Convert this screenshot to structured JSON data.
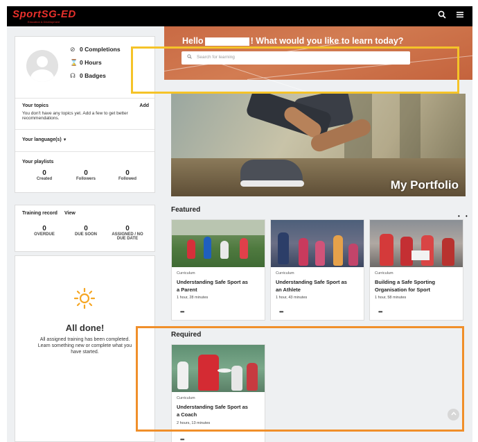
{
  "app": {
    "logo": "SportSG-ED",
    "logo_sub": "Education & Development"
  },
  "header": {
    "search_icon": "search-icon",
    "menu_icon": "hamburger-menu-icon"
  },
  "hero": {
    "greeting_before": "Hello",
    "greeting_after": "! What would you like to learn today?",
    "search_placeholder": "Search for learning"
  },
  "profile": {
    "completions": "0",
    "completions_label": "Completions",
    "hours": "0",
    "hours_label": "Hours",
    "badges": "0",
    "badges_label": "Badges"
  },
  "topics": {
    "title": "Your topics",
    "add": "Add",
    "empty_text": "You don't have any topics yet. Add a few to get better recommendations."
  },
  "languages": {
    "title": "Your language(s)",
    "chevron": "▼"
  },
  "playlists": {
    "title": "Your playlists",
    "created": "0",
    "created_label": "Created",
    "followers": "0",
    "followers_label": "Followers",
    "followed": "0",
    "followed_label": "Followed"
  },
  "training": {
    "title": "Training record",
    "view": "View",
    "overdue": "0",
    "overdue_label": "OVERDUE",
    "due_soon": "0",
    "due_soon_label": "DUE SOON",
    "assigned": "0",
    "assigned_label_1": "ASSIGNED / NO",
    "assigned_label_2": "DUE DATE"
  },
  "all_done": {
    "title": "All done!",
    "line1": "All assigned training has been completed.",
    "line2": "Learn something new or complete what you",
    "line3": "have started."
  },
  "portfolio": {
    "title": "My Portfolio"
  },
  "featured": {
    "title": "Featured",
    "courses": [
      {
        "category": "Curriculum",
        "title_1": "Understanding Safe Sport as",
        "title_2": "a Parent",
        "duration": "1 hour, 28 minutes",
        "more": "•••"
      },
      {
        "category": "Curriculum",
        "title_1": "Understanding Safe Sport as",
        "title_2": "an Athlete",
        "duration": "1 hour, 43 minutes",
        "more": "•••"
      },
      {
        "category": "Curriculum",
        "title_1": "Building a Safe Sporting",
        "title_2": "Organisation for Sport",
        "duration": "1 hour, 58 minutes",
        "more": "•••"
      }
    ]
  },
  "required": {
    "title": "Required",
    "courses": [
      {
        "category": "Curriculum",
        "title_1": "Understanding Safe Sport as",
        "title_2": "a Coach",
        "duration": "2 hours, 13 minutes",
        "more": "•••"
      }
    ]
  },
  "carousel": {
    "dots": "• •"
  },
  "colors": {
    "brand": "#e8302b",
    "hero": "#cf7450",
    "highlight_yellow": "#f5c328",
    "highlight_orange": "#f08f2a"
  }
}
